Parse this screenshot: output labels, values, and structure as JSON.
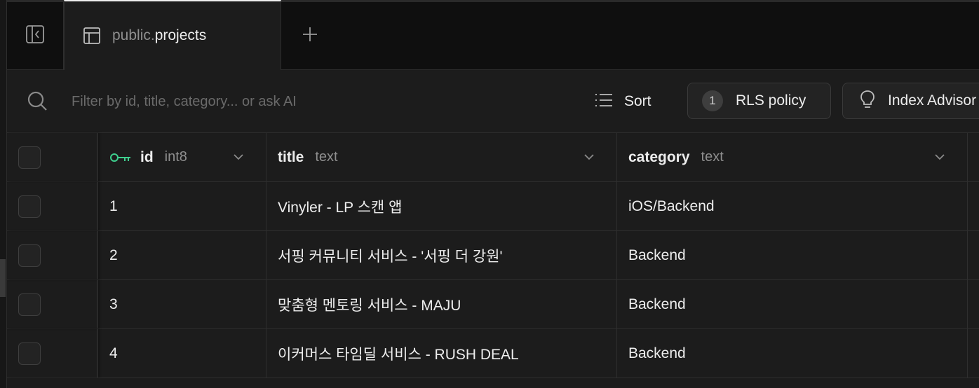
{
  "tabs": {
    "active": {
      "schema": "public.",
      "table": "projects"
    },
    "new_tab_symbol": "+"
  },
  "toolbar": {
    "search_placeholder": "Filter by id, title, category... or ask AI",
    "sort_label": "Sort",
    "rls_count": "1",
    "rls_label": "RLS policy",
    "index_label": "Index Advisor"
  },
  "columns": [
    {
      "name": "id",
      "type": "int8",
      "primary_key": true
    },
    {
      "name": "title",
      "type": "text"
    },
    {
      "name": "category",
      "type": "text"
    }
  ],
  "rows": [
    {
      "id": "1",
      "title": "Vinyler - LP 스캔 앱",
      "category": "iOS/Backend"
    },
    {
      "id": "2",
      "title": "서핑 커뮤니티 서비스 - '서핑 더 강원'",
      "category": "Backend"
    },
    {
      "id": "3",
      "title": "맞춤형 멘토링 서비스 - MAJU",
      "category": "Backend"
    },
    {
      "id": "4",
      "title": "이커머스 타임딜 서비스 - RUSH DEAL",
      "category": "Backend"
    }
  ],
  "colors": {
    "accent_key": "#3ecf8e",
    "background": "#1c1c1c",
    "border": "#2e2e2e"
  },
  "icons": [
    "panel-toggle-icon",
    "table-icon",
    "plus-icon",
    "search-icon",
    "sort-list-icon",
    "lightbulb-icon",
    "key-icon",
    "chevron-down-icon"
  ]
}
